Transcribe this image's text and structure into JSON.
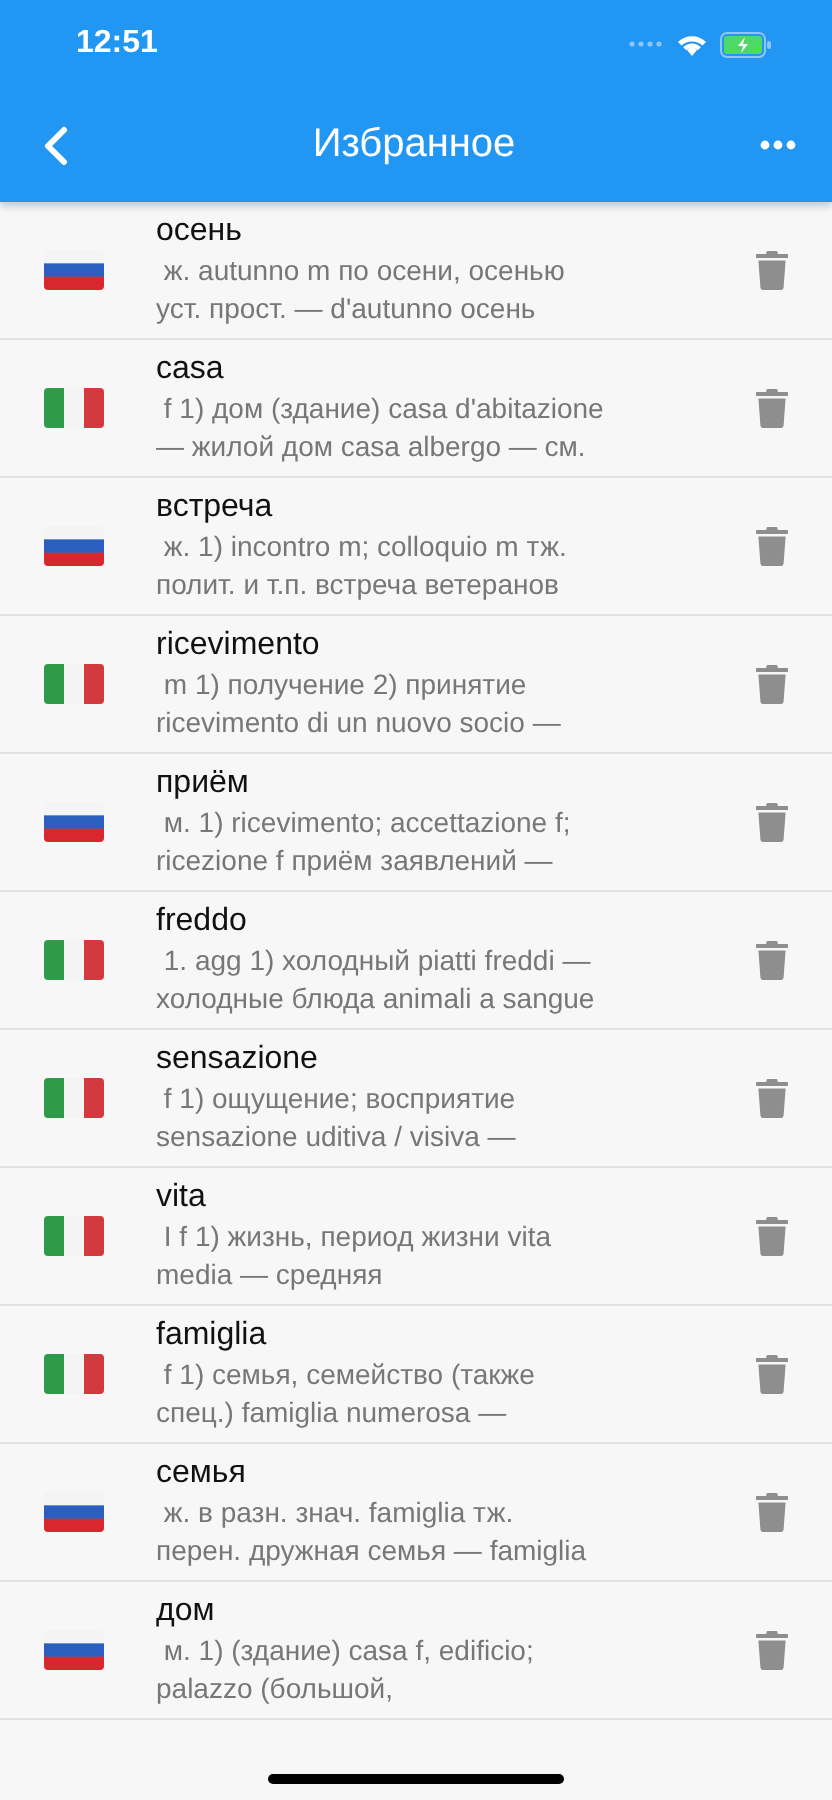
{
  "status_bar": {
    "time": "12:51"
  },
  "header": {
    "title": "Избранное"
  },
  "entries": [
    {
      "kind": "ru",
      "word": "осень",
      "lines": [
        " ж. autunno m по осени, осенью",
        "уст. прост. — d'autunno осень"
      ]
    },
    {
      "kind": "it",
      "word": "casa",
      "lines": [
        " f 1) дом (здание) casa d'abitazione",
        "— жилой дом casa albergo — см."
      ]
    },
    {
      "kind": "ru",
      "word": "встреча",
      "lines": [
        " ж. 1) incontro m; colloquio m тж.",
        "полит. и т.п. встреча ветеранов"
      ]
    },
    {
      "kind": "it",
      "word": "ricevimento",
      "lines": [
        " m 1) получение 2) принятие",
        "ricevimento di un nuovo socio —"
      ]
    },
    {
      "kind": "ru",
      "word": "приём",
      "lines": [
        " м. 1) ricevimento; accettazione f;",
        "ricezione f приём заявлений —"
      ]
    },
    {
      "kind": "it",
      "word": "freddo",
      "lines": [
        " 1. agg 1) холодный piatti freddi —",
        "холодные блюда animali a sangue"
      ]
    },
    {
      "kind": "it",
      "word": "sensazione",
      "lines": [
        " f 1) ощущение; восприятие",
        "sensazione uditiva / visiva —"
      ]
    },
    {
      "kind": "it",
      "word": "vita",
      "lines": [
        " I f 1) жизнь, период жизни vita",
        "media — средняя"
      ]
    },
    {
      "kind": "it",
      "word": "famiglia",
      "lines": [
        " f 1) семья, семейство (также",
        "спец.) famiglia numerosa —"
      ]
    },
    {
      "kind": "ru",
      "word": "семья",
      "lines": [
        " ж. в разн. знач. famiglia тж.",
        "перен. дружная семья — famiglia"
      ]
    },
    {
      "kind": "ru",
      "word": "дом",
      "lines": [
        " м. 1) (здание) casa f, edificio;",
        "palazzo (большой,"
      ]
    }
  ]
}
